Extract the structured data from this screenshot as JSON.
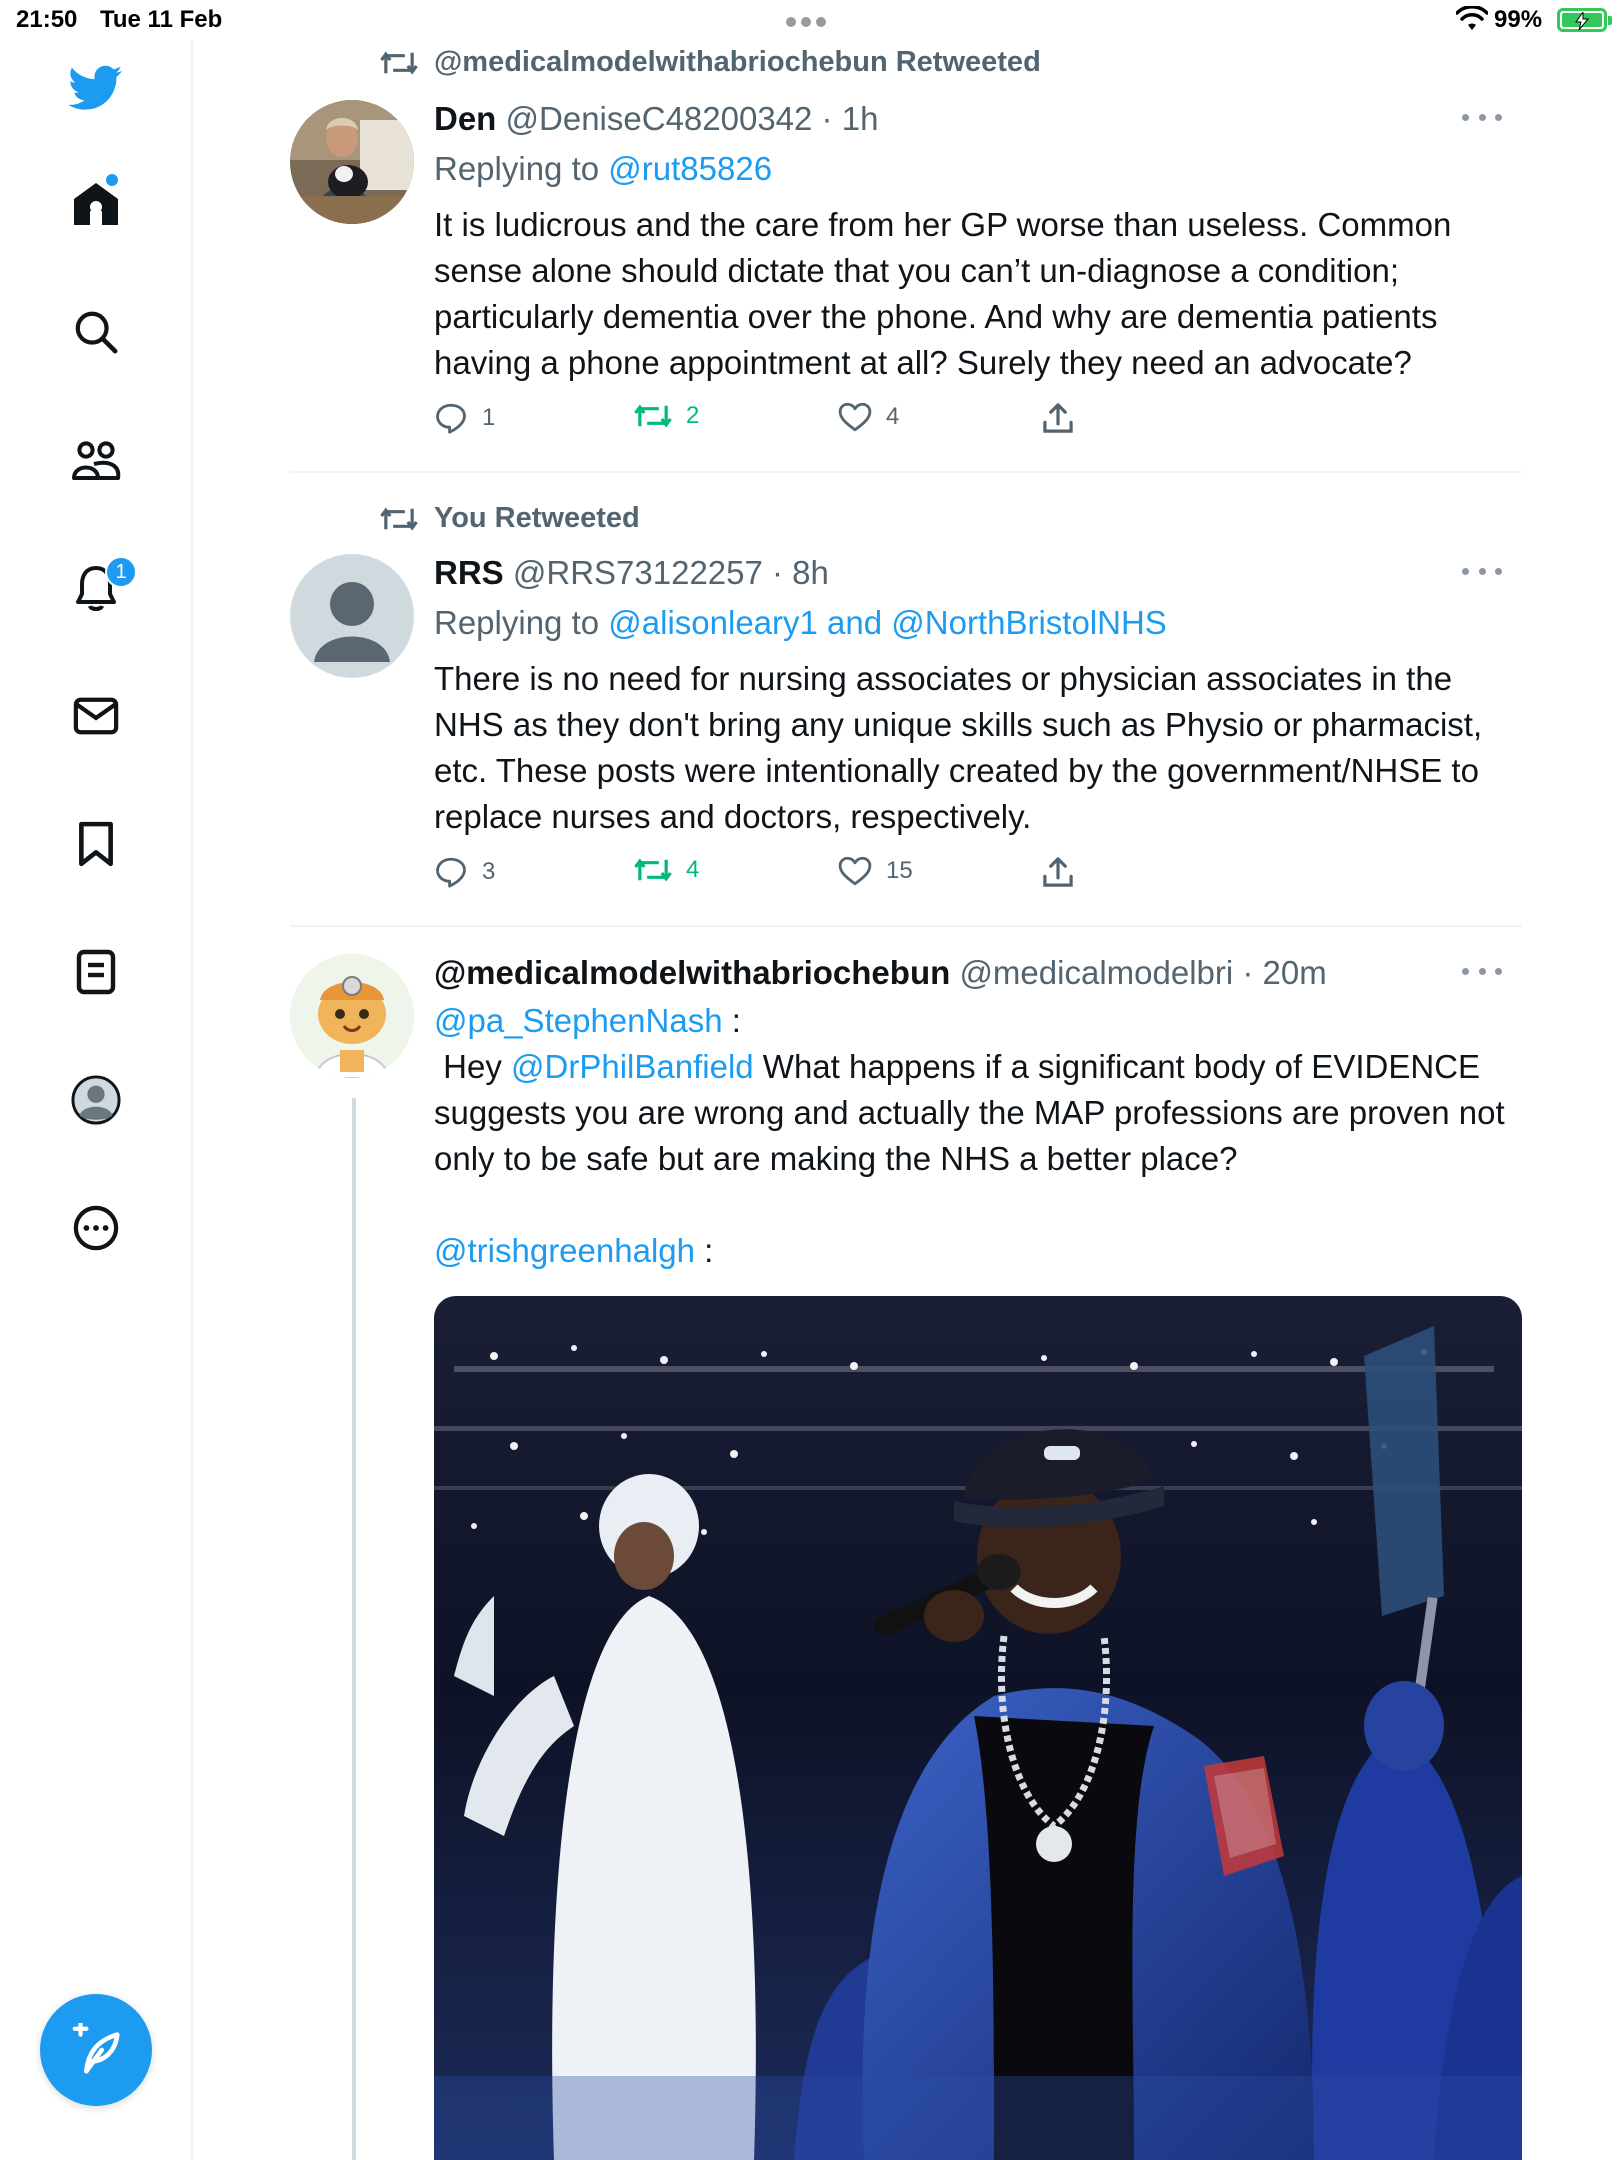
{
  "status_bar": {
    "time": "21:50",
    "date": "Tue 11 Feb",
    "battery": "99%"
  },
  "sidebar": {
    "items": [
      "twitter-logo",
      "home",
      "search",
      "communities",
      "notifications",
      "messages",
      "bookmarks",
      "lists",
      "profile",
      "more"
    ],
    "notifications_badge": "1"
  },
  "tweets": [
    {
      "retweet_label": "@medicalmodelwithabriochebun Retweeted",
      "name": "Den",
      "handle_time": "@DeniseC48200342 · 1h",
      "replying_prefix": "Replying to ",
      "replying_to": "@rut85826",
      "text": "It is ludicrous and the care from her GP worse than useless. Common sense alone should dictate that you can’t un-diagnose a condition; particularly dementia over the phone. And why are dementia patients having a phone appointment at all? Surely they need an advocate?",
      "replies": "1",
      "retweets": "2",
      "likes": "4"
    },
    {
      "retweet_label": "You Retweeted",
      "name": "RRS",
      "handle_time": "@RRS73122257 · 8h",
      "replying_prefix": "Replying to ",
      "replying_to": "@alisonleary1 and @NorthBristolNHS",
      "text": "There is no need for nursing associates or physician associates in the NHS as they don't bring any unique skills such as Physio or pharmacist, etc.  These posts were intentionally created by the government/NHSE to replace nurses and doctors, respectively.",
      "replies": "3",
      "retweets": "4",
      "likes": "15"
    },
    {
      "name": "@medicalmodelwithabriochebun",
      "handle_time": "@medicalmodelbri · 20m",
      "mention1": "@pa_StephenNash",
      "colon": " :",
      "hey": " Hey ",
      "mention2": "@DrPhilBanfield",
      "text": " What happens if a significant body of EVIDENCE suggests you are wrong and actually the MAP professions are proven not only to be safe but are making the NHS a better place?",
      "mention3": "@trishgreenhalgh",
      "colon2": " :"
    }
  ],
  "colors": {
    "accent": "#1d9bf0",
    "secondary": "#536471",
    "retweet_green": "#00ba7c",
    "text": "#0f1419"
  }
}
